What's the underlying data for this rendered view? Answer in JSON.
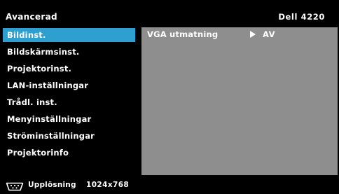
{
  "header": {
    "title": "Avancerad",
    "model": "Dell 4220"
  },
  "sidebar": {
    "items": [
      {
        "label": "Bildinst.",
        "active": true
      },
      {
        "label": "Bildskärmsinst.",
        "active": false
      },
      {
        "label": "Projektorinst.",
        "active": false
      },
      {
        "label": "LAN-inställningar",
        "active": false
      },
      {
        "label": "Trådl. inst.",
        "active": false
      },
      {
        "label": "Menyinställningar",
        "active": false
      },
      {
        "label": "Ströminställningar",
        "active": false
      },
      {
        "label": "Projektorinfo",
        "active": false
      }
    ]
  },
  "panel": {
    "setting_label": "VGA utmatning",
    "setting_value": "AV",
    "arrow_icon": "right-triangle-icon"
  },
  "footer": {
    "icon": "vga-connector-icon",
    "label": "Upplösning",
    "value": "1024x768"
  },
  "colors": {
    "background": "#000000",
    "selected": "#2e9fcf",
    "panel": "#8e8e8e",
    "text": "#ffffff"
  }
}
